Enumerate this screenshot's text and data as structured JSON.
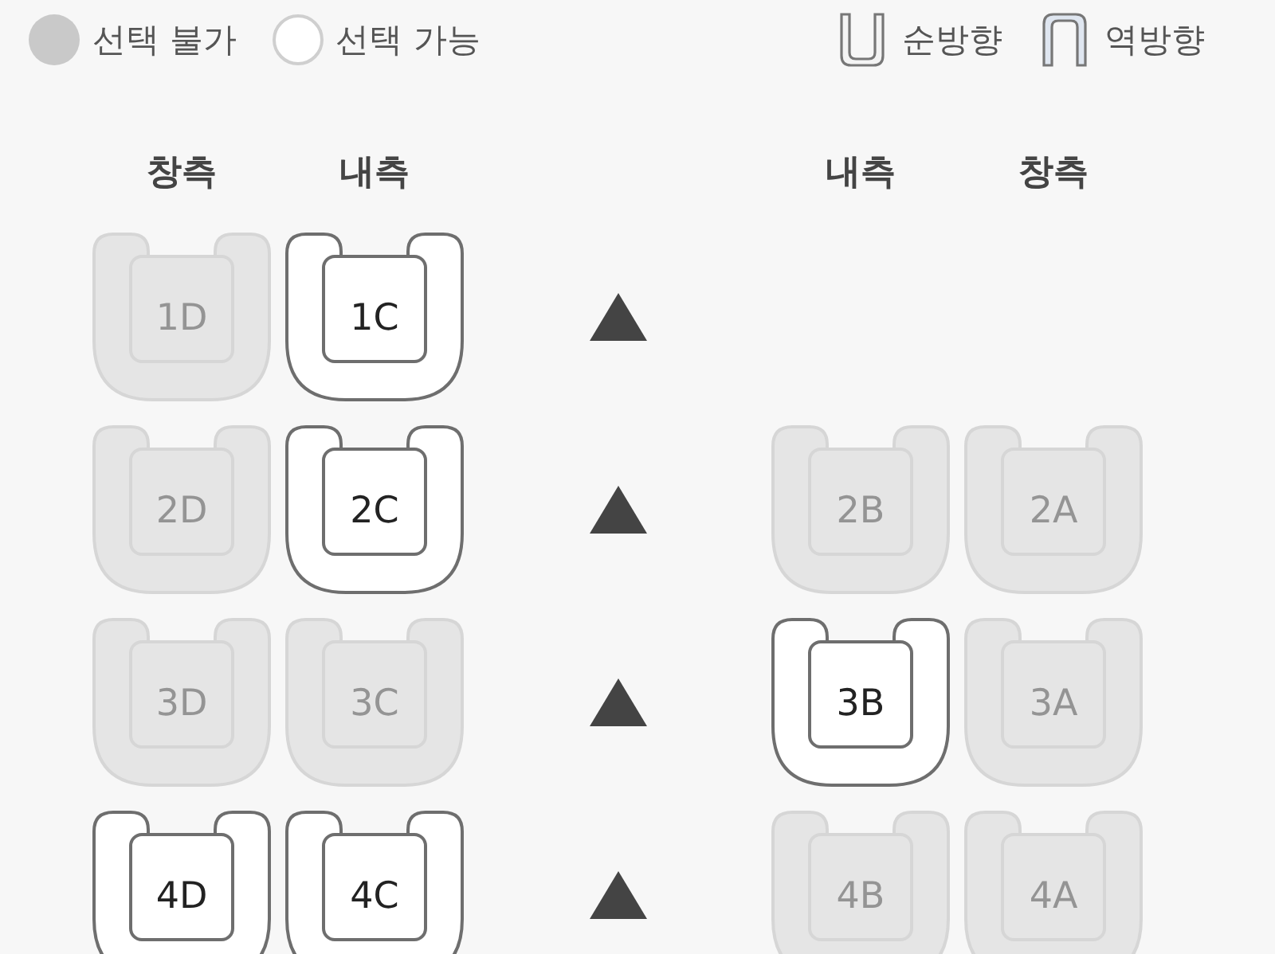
{
  "legend": [
    {
      "kind": "unavailable",
      "label": "선택 불가"
    },
    {
      "kind": "available",
      "label": "선택 가능"
    },
    {
      "kind": "forward",
      "label": "순방향"
    },
    {
      "kind": "reverse",
      "label": "역방향"
    }
  ],
  "headers": {
    "left": [
      "창측",
      "내측"
    ],
    "right": [
      "내측",
      "창측"
    ]
  },
  "rows": [
    {
      "left": [
        {
          "label": "1D",
          "available": false
        },
        {
          "label": "1C",
          "available": true
        }
      ]
    },
    {
      "left": [
        {
          "label": "2D",
          "available": false
        },
        {
          "label": "2C",
          "available": true
        }
      ],
      "right": [
        {
          "label": "2B",
          "available": false
        },
        {
          "label": "2A",
          "available": false
        }
      ]
    },
    {
      "left": [
        {
          "label": "3D",
          "available": false
        },
        {
          "label": "3C",
          "available": false
        }
      ],
      "right": [
        {
          "label": "3B",
          "available": true
        },
        {
          "label": "3A",
          "available": false
        }
      ]
    },
    {
      "left": [
        {
          "label": "4D",
          "available": true
        },
        {
          "label": "4C",
          "available": true
        }
      ],
      "right": [
        {
          "label": "4B",
          "available": false
        },
        {
          "label": "4A",
          "available": false
        }
      ]
    }
  ]
}
